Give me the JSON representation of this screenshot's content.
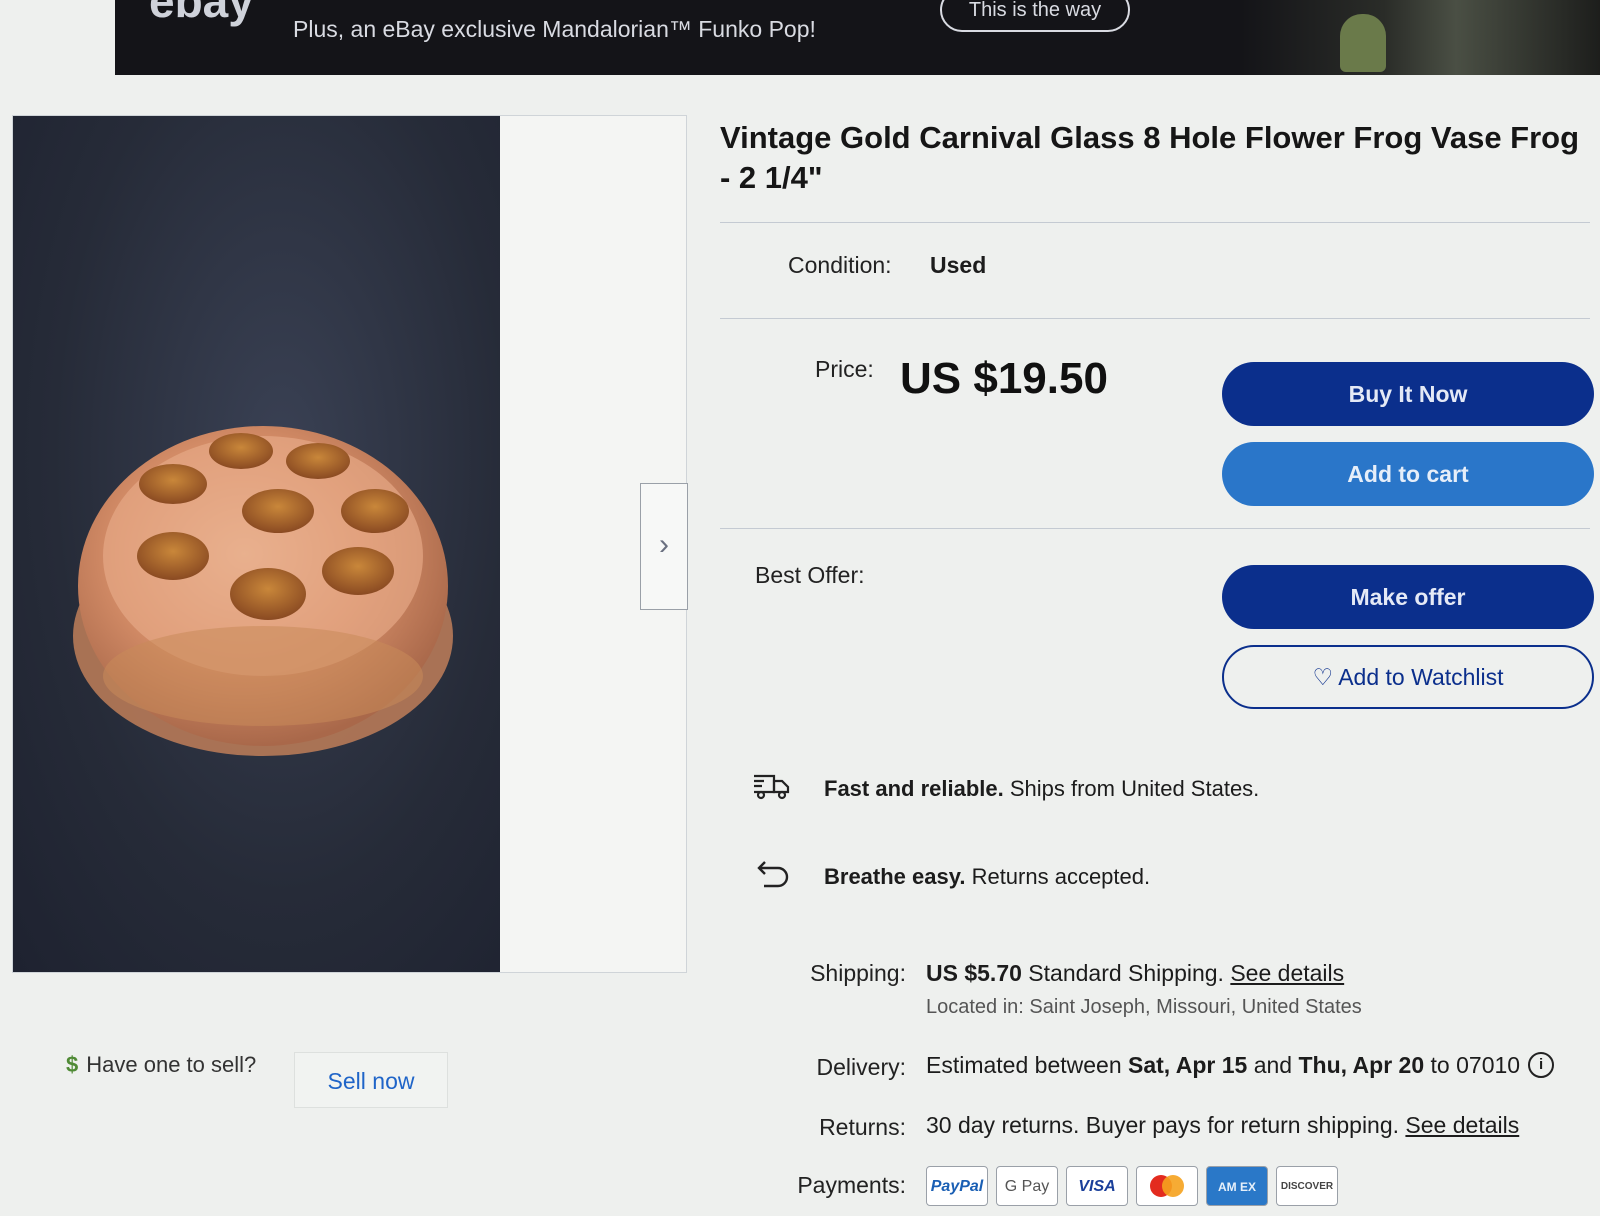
{
  "banner": {
    "logo": "ebay",
    "promo": "Plus, an eBay exclusive Mandalorian™ Funko Pop!",
    "cta": "This is the way"
  },
  "gallery": {
    "next_label": "›"
  },
  "listing": {
    "title": "Vintage Gold Carnival Glass 8 Hole Flower Frog Vase Frog - 2 1/4\"",
    "condition_label": "Condition:",
    "condition_value": "Used",
    "price_label": "Price:",
    "price_value": "US $19.50",
    "best_offer_label": "Best Offer:"
  },
  "buttons": {
    "buy_now": "Buy It Now",
    "add_to_cart": "Add to cart",
    "make_offer": "Make offer",
    "watchlist": "Add to Watchlist"
  },
  "features": {
    "shipping_bold": "Fast and reliable.",
    "shipping_text": " Ships from United States.",
    "returns_bold": "Breathe easy.",
    "returns_text": " Returns accepted."
  },
  "details": {
    "shipping_label": "Shipping:",
    "shipping_price": "US $5.70",
    "shipping_method": " Standard Shipping. ",
    "shipping_link": "See details",
    "location": "Located in: Saint Joseph, Missouri, United States",
    "delivery_label": "Delivery:",
    "delivery_prefix": "Estimated between ",
    "delivery_start": "Sat, Apr 15",
    "delivery_and": " and ",
    "delivery_end": "Thu, Apr 20",
    "delivery_zip": " to 07010",
    "returns_label": "Returns:",
    "returns_text": "30 day returns. Buyer pays for return shipping. ",
    "returns_link": "See details",
    "payments_label": "Payments:"
  },
  "payments": [
    "PayPal",
    "G Pay",
    "VISA",
    "",
    "AM EX",
    "DISCOVER"
  ],
  "sell": {
    "question": "Have one to sell?",
    "button": "Sell now"
  },
  "colors": {
    "primary": "#0b2f8c",
    "secondary": "#2a76c9",
    "link": "#1f64c8"
  }
}
